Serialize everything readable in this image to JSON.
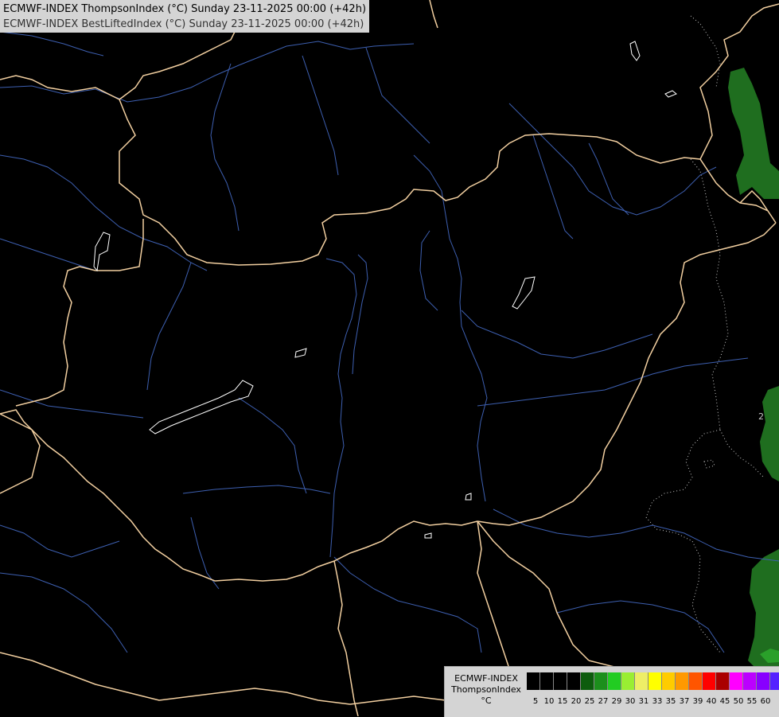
{
  "header": {
    "line1": "ECMWF-INDEX ThompsonIndex (°C) Sunday 23-11-2025 00:00 (+42h)",
    "line2": "ECMWF-INDEX BestLiftedIndex (°C) Sunday 23-11-2025 00:00 (+42h)"
  },
  "map": {
    "background": "#000000",
    "border_color": "#f2cfa0",
    "river_color": "#3d5fb0",
    "lake_color": "#ffffff",
    "contour_color": "#c8c8c8",
    "contour_label": "2",
    "shaded_regions": [
      {
        "color": "#1f6e1f",
        "class": "20"
      },
      {
        "color": "#1f6e1f",
        "class": "20"
      },
      {
        "color": "#2aa02a",
        "class": "25"
      }
    ]
  },
  "legend": {
    "label_lines": [
      "ECMWF-INDEX",
      "ThompsonIndex",
      "°C"
    ],
    "colors": [
      "#000000",
      "#000000",
      "#000000",
      "#000000",
      "#0d5c0d",
      "#1c8f1c",
      "#22cc22",
      "#99ee33",
      "#eeee66",
      "#ffff00",
      "#ffcc00",
      "#ff9900",
      "#ff5500",
      "#ff0000",
      "#aa0000",
      "#ff00ff",
      "#bb00ff",
      "#8800ff",
      "#5522ff",
      "#0000ff"
    ],
    "ticks": [
      "5",
      "10",
      "15",
      "20",
      "25",
      "27",
      "29",
      "30",
      "31",
      "33",
      "35",
      "37",
      "39",
      "40",
      "45",
      "50",
      "55",
      "60"
    ]
  }
}
